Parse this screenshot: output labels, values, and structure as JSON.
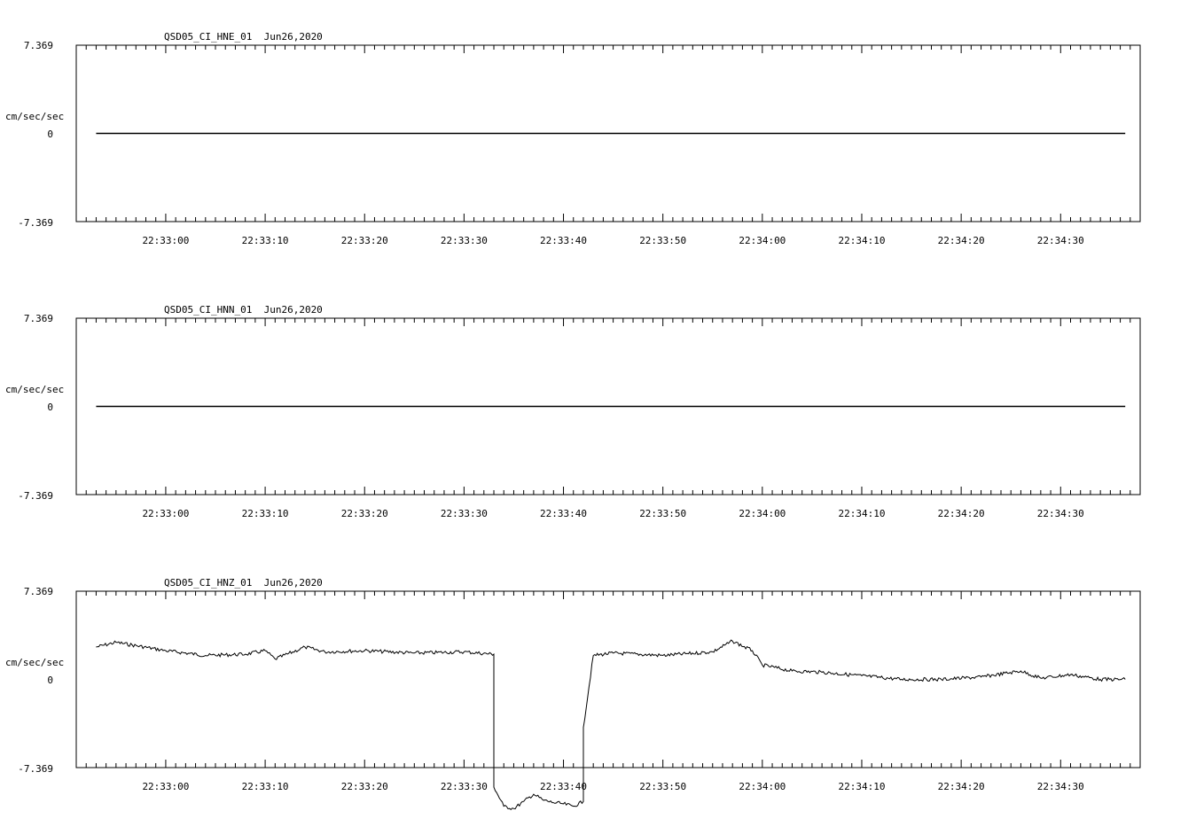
{
  "charts": [
    {
      "title": "QSD05_CI_HNE_01  Jun26,2020",
      "ylabel": "cm/sec/sec",
      "ytick_labels": [
        "7.369",
        "0",
        "-7.369"
      ],
      "xtick_labels": [
        "22:33:00",
        "22:33:10",
        "22:33:20",
        "22:33:30",
        "22:33:40",
        "22:33:50",
        "22:34:00",
        "22:34:10",
        "22:34:20",
        "22:34:30"
      ]
    },
    {
      "title": "QSD05_CI_HNN_01  Jun26,2020",
      "ylabel": "cm/sec/sec",
      "ytick_labels": [
        "7.369",
        "0",
        "-7.369"
      ],
      "xtick_labels": [
        "22:33:00",
        "22:33:10",
        "22:33:20",
        "22:33:30",
        "22:33:40",
        "22:33:50",
        "22:34:00",
        "22:34:10",
        "22:34:20",
        "22:34:30"
      ]
    },
    {
      "title": "QSD05_CI_HNZ_01  Jun26,2020",
      "ylabel": "cm/sec/sec",
      "ytick_labels": [
        "7.369",
        "0",
        "-7.369"
      ],
      "xtick_labels": [
        "22:33:00",
        "22:33:10",
        "22:33:20",
        "22:33:30",
        "22:33:40",
        "22:33:50",
        "22:34:00",
        "22:34:10",
        "22:34:20",
        "22:34:30"
      ]
    }
  ],
  "chart_data": [
    {
      "type": "line",
      "title": "QSD05_CI_HNE_01  Jun26,2020",
      "ylabel": "cm/sec/sec",
      "ylim": [
        -7.369,
        7.369
      ],
      "xlim": [
        "22:32:51",
        "22:34:38"
      ],
      "series": [
        {
          "x": [
            "22:32:53",
            "22:34:36.5"
          ],
          "y": [
            0,
            0
          ]
        }
      ]
    },
    {
      "type": "line",
      "title": "QSD05_CI_HNN_01  Jun26,2020",
      "ylabel": "cm/sec/sec",
      "ylim": [
        -7.369,
        7.369
      ],
      "xlim": [
        "22:32:51",
        "22:34:38"
      ],
      "series": [
        {
          "x": [
            "22:32:53",
            "22:34:36.5"
          ],
          "y": [
            0,
            0
          ]
        }
      ]
    },
    {
      "type": "line",
      "title": "QSD05_CI_HNZ_01  Jun26,2020",
      "ylabel": "cm/sec/sec",
      "ylim": [
        -7.369,
        7.369
      ],
      "xlim": [
        "22:32:51",
        "22:34:38"
      ],
      "series": [
        {
          "x": [
            "22:32:53",
            "22:32:55",
            "22:33:00",
            "22:33:04",
            "22:33:08",
            "22:33:10",
            "22:33:11",
            "22:33:14",
            "22:33:16",
            "22:33:20",
            "22:33:25",
            "22:33:30",
            "22:33:33",
            "22:33:33",
            "22:33:34",
            "22:33:35",
            "22:33:36",
            "22:33:37",
            "22:33:38",
            "22:33:39",
            "22:33:40",
            "22:33:41",
            "22:33:42",
            "22:33:42",
            "22:33:43",
            "22:33:45",
            "22:33:50",
            "22:33:55",
            "22:33:57",
            "22:33:59",
            "22:34:00",
            "22:34:03",
            "22:34:06",
            "22:34:10",
            "22:34:14",
            "22:34:18",
            "22:34:22",
            "22:34:26",
            "22:34:28",
            "22:34:31",
            "22:34:34",
            "22:34:36.5"
          ],
          "y": [
            2.7,
            3.1,
            2.4,
            2.0,
            2.1,
            2.4,
            1.7,
            2.7,
            2.3,
            2.4,
            2.2,
            2.3,
            2.1,
            -9.0,
            -10.6,
            -10.8,
            -10.2,
            -9.6,
            -10.1,
            -10.3,
            -10.4,
            -10.6,
            -10.2,
            -4.0,
            2.0,
            2.2,
            2.0,
            2.3,
            3.2,
            2.4,
            1.2,
            0.7,
            0.6,
            0.3,
            0.0,
            0.0,
            0.2,
            0.7,
            0.1,
            0.4,
            0.0,
            0.0
          ]
        }
      ]
    }
  ]
}
